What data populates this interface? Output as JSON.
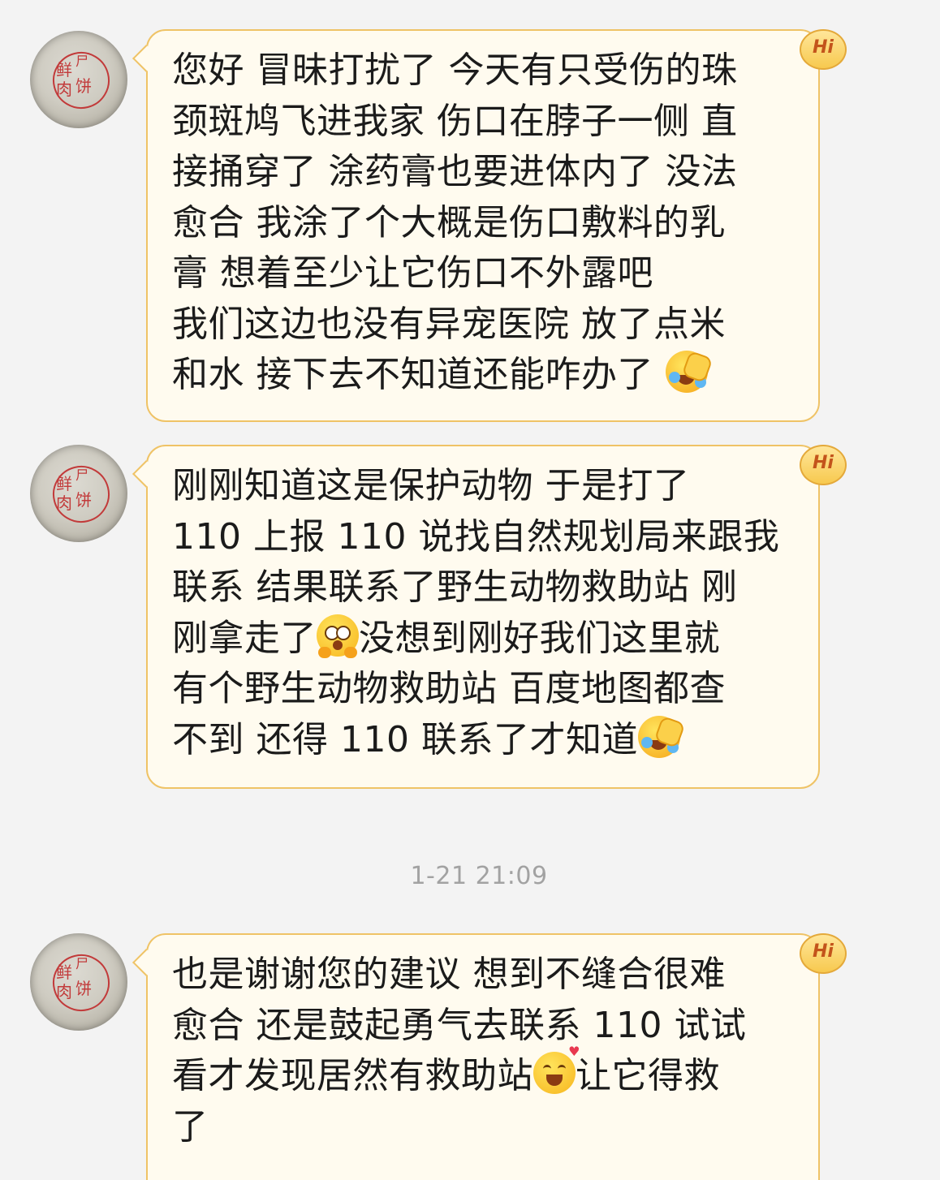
{
  "messages": [
    {
      "lines": [
        "您好 冒昧打扰了 今天有只受伤的珠",
        "颈斑鸠飞进我家 伤口在脖子一侧 直",
        "接捅穿了 涂药膏也要进体内了 没法",
        "愈合 我涂了个大概是伤口敷料的乳",
        "膏 想着至少让它伤口不外露吧",
        "我们这边也没有异宠医院 放了点米",
        "和水 接下去不知道还能咋办了"
      ],
      "end_emoji": "facepalm-laugh-cry-emoji"
    },
    {
      "lines": [
        "刚刚知道这是保护动物 于是打了",
        "110 上报 110 说找自然规划局来跟我",
        "联系 结果联系了野生动物救助站 刚",
        "刚拿走了",
        "没想到刚好我们这里就",
        "有个野生动物救助站 百度地图都查",
        "不到 还得 110 联系了才知道"
      ],
      "inline_emoji": "shocked-wow-emoji",
      "end_emoji": "facepalm-laugh-cry-emoji"
    },
    {
      "lines": [
        "也是谢谢您的建议 想到不缝合很难",
        "愈合 还是鼓起勇气去联系 110 试试",
        "看才发现居然有救助站",
        "让它得救",
        "了"
      ],
      "inline_emoji": "blushing-love-emoji"
    }
  ],
  "timestamp": "1-21 21:09",
  "badge_label": "Hi",
  "avatar_seal_text": [
    "鲜",
    "尸",
    "肉",
    "饼"
  ],
  "colors": {
    "background": "#f3f3f3",
    "bubble_fill": "#fffbef",
    "bubble_border": "#efc366",
    "timestamp_text": "#a2a2a2"
  }
}
